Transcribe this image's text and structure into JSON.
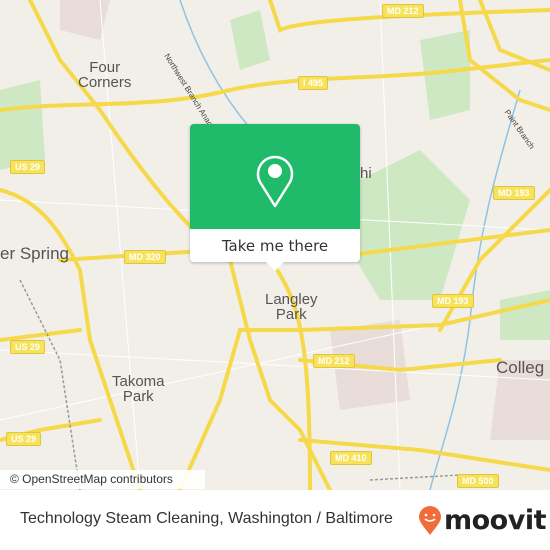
{
  "map": {
    "places": {
      "four_corners": "Four\nCorners",
      "silver_spring": "er Spring",
      "langley_park": "Langley\nPark",
      "takoma_park": "Takoma\nPark",
      "college": "Colleg",
      "adelphi": "hi"
    },
    "shields": {
      "md212_top": "MD 212",
      "i495": "I 495",
      "us29_a": "US 29",
      "us29_b": "US 29",
      "us29_c": "US 29",
      "md320": "MD 320",
      "md193_a": "MD 193",
      "md193_b": "MD 193",
      "md212_bottom": "MD 212",
      "md410": "MD 410",
      "md500": "MD 500"
    },
    "rivers": {
      "northwest_branch": "Northwest Branch Anacostia River",
      "paint_branch": "Paint Branch"
    },
    "attribution": "© OpenStreetMap contributors",
    "colors": {
      "popup": "#1fba6a",
      "road": "#f7e35a",
      "brand": "#f26b3a"
    }
  },
  "popup": {
    "button_label": "Take me there",
    "icon": "location-pin-icon"
  },
  "footer": {
    "title": "Technology Steam Cleaning, Washington / Baltimore",
    "logo_text": "moovit"
  }
}
